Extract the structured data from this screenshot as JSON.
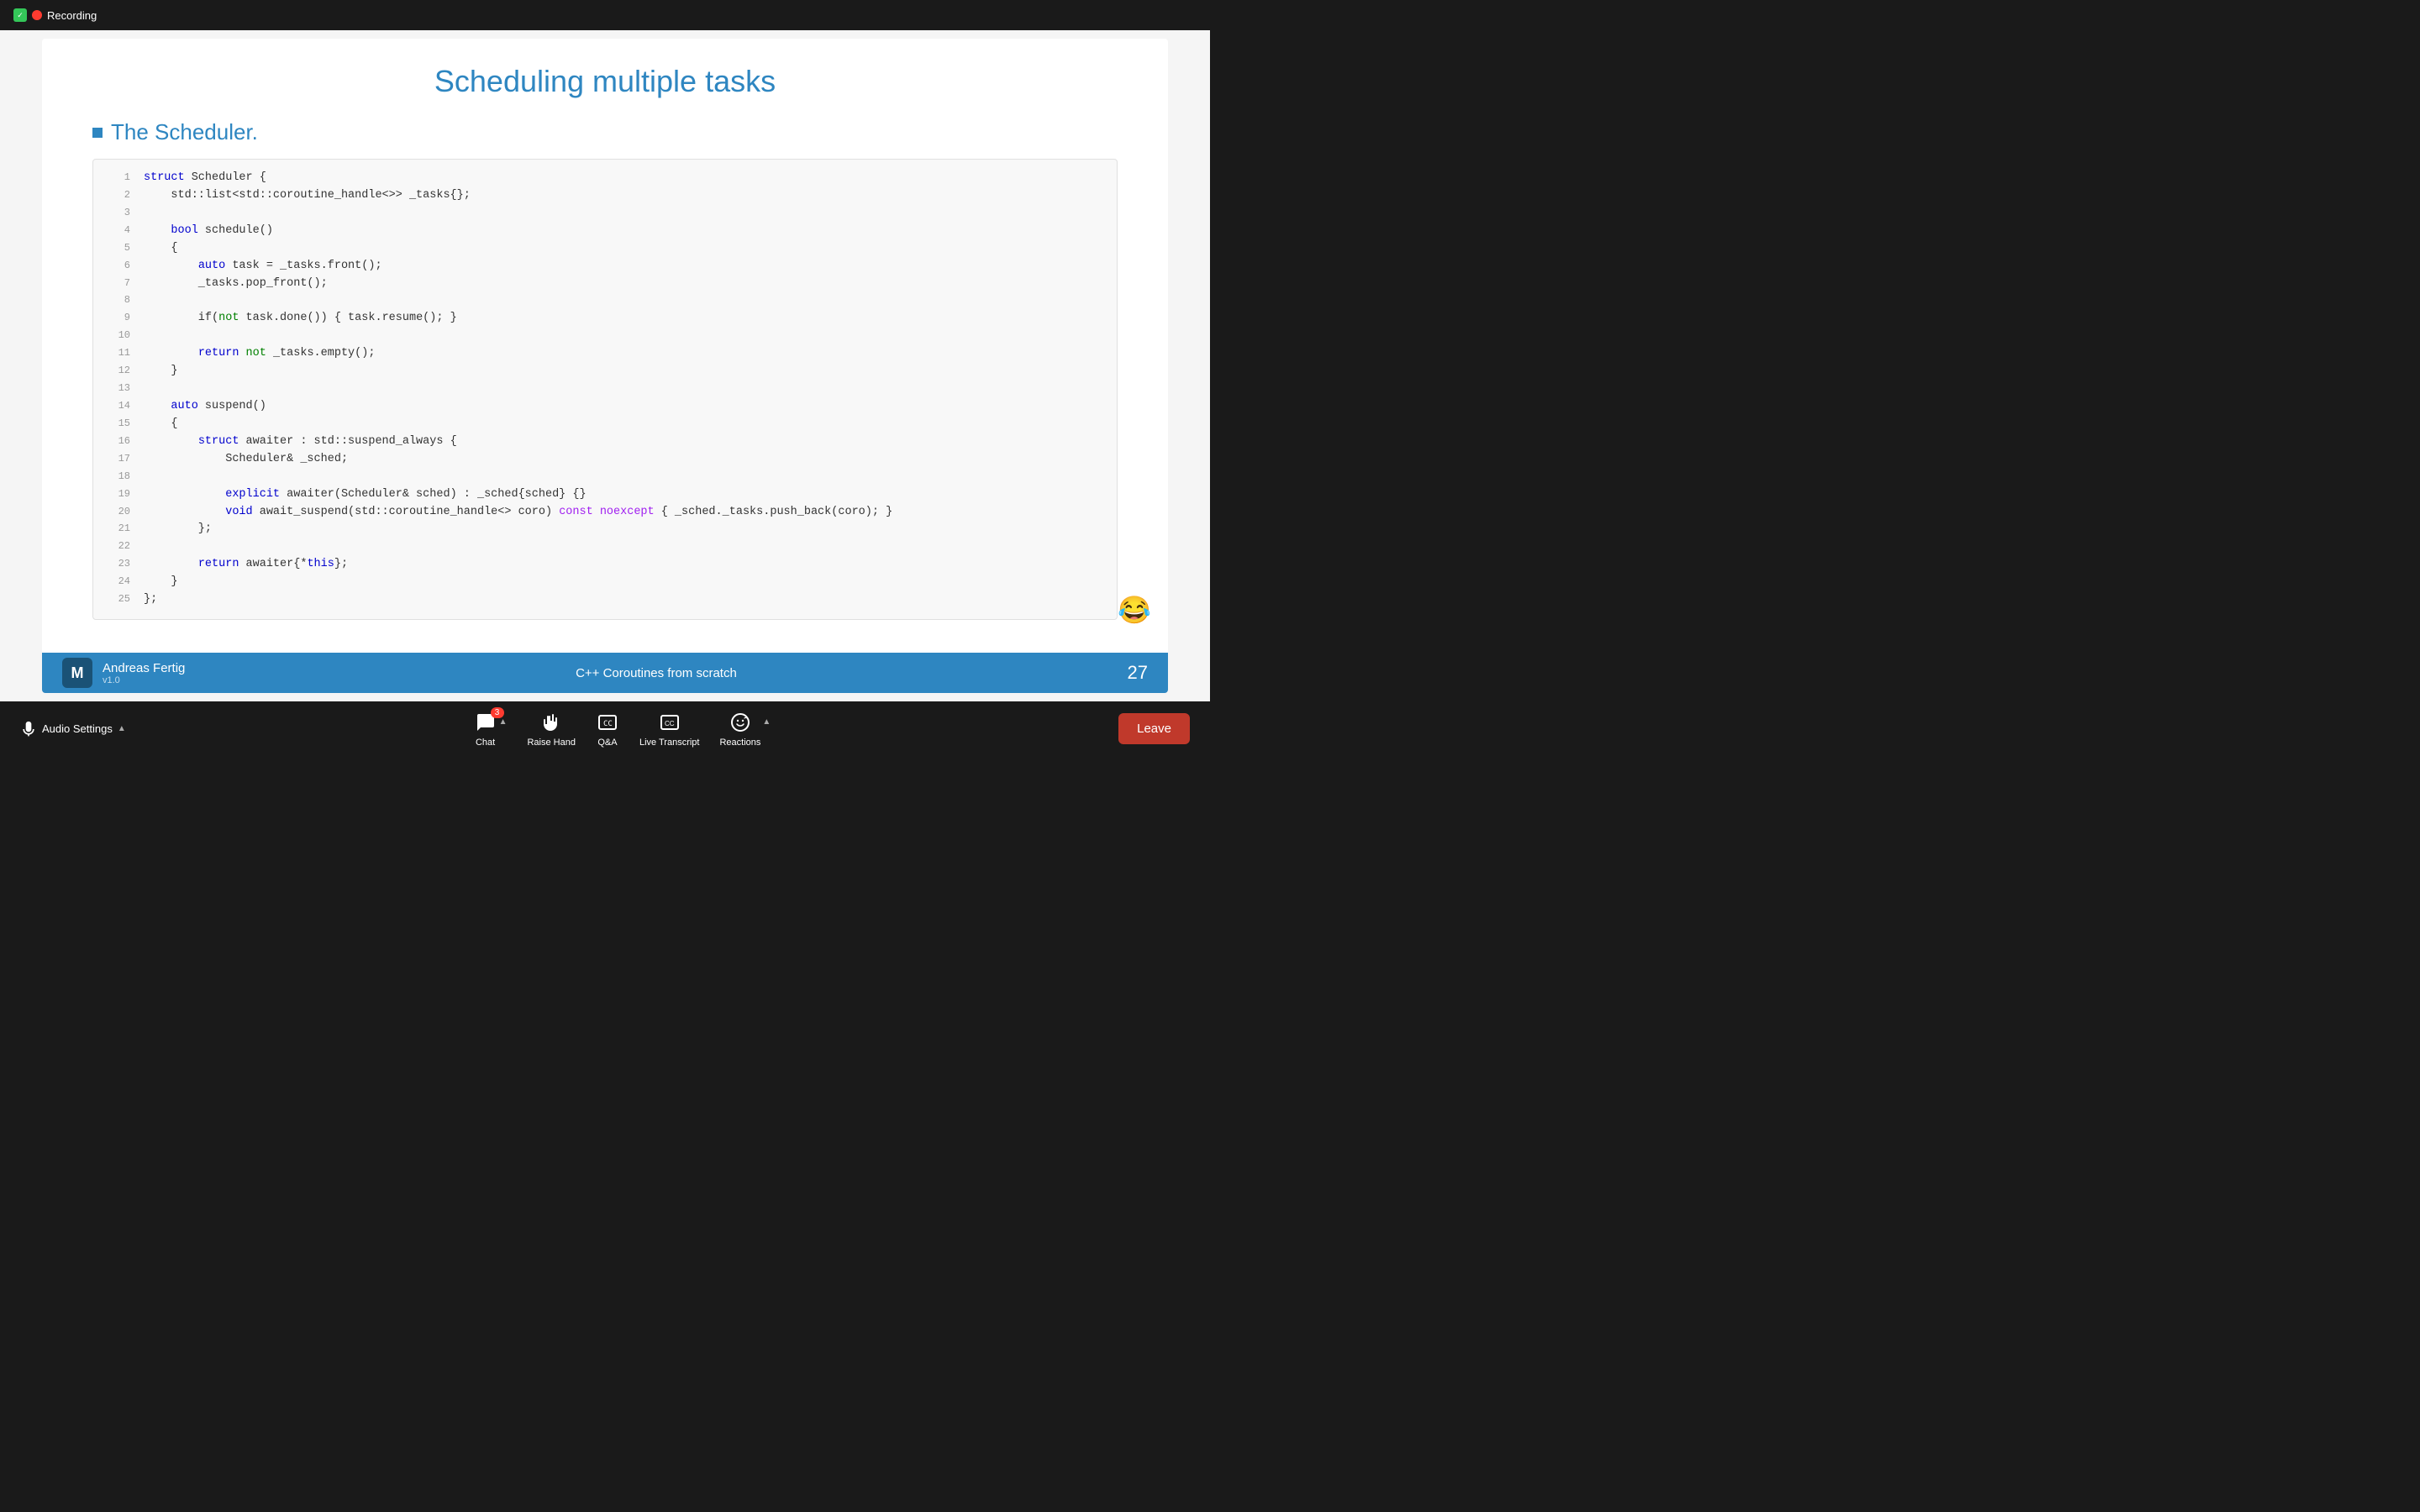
{
  "topbar": {
    "shield_label": "✓",
    "recording_label": "Recording"
  },
  "slide": {
    "title": "Scheduling multiple tasks",
    "section_title": "The Scheduler.",
    "code_lines": [
      {
        "num": 1,
        "text": "struct Scheduler {"
      },
      {
        "num": 2,
        "text": "    std::list<std::coroutine_handle<>> _tasks{};"
      },
      {
        "num": 3,
        "text": ""
      },
      {
        "num": 4,
        "text": "    bool schedule()"
      },
      {
        "num": 5,
        "text": "    {"
      },
      {
        "num": 6,
        "text": "        auto task = _tasks.front();"
      },
      {
        "num": 7,
        "text": "        _tasks.pop_front();"
      },
      {
        "num": 8,
        "text": ""
      },
      {
        "num": 9,
        "text": "        if(not task.done()) { task.resume(); }"
      },
      {
        "num": 10,
        "text": ""
      },
      {
        "num": 11,
        "text": "        return not _tasks.empty();"
      },
      {
        "num": 12,
        "text": "    }"
      },
      {
        "num": 13,
        "text": ""
      },
      {
        "num": 14,
        "text": "    auto suspend()"
      },
      {
        "num": 15,
        "text": "    {"
      },
      {
        "num": 16,
        "text": "        struct awaiter : std::suspend_always {"
      },
      {
        "num": 17,
        "text": "            Scheduler& _sched;"
      },
      {
        "num": 18,
        "text": ""
      },
      {
        "num": 19,
        "text": "            explicit awaiter(Scheduler& sched) : _sched{sched} {}"
      },
      {
        "num": 20,
        "text": "            void await_suspend(std::coroutine_handle<> coro) const noexcept { _sched._tasks.push_back(coro); }"
      },
      {
        "num": 21,
        "text": "        };"
      },
      {
        "num": 22,
        "text": ""
      },
      {
        "num": 23,
        "text": "        return awaiter{*this};"
      },
      {
        "num": 24,
        "text": "    }"
      },
      {
        "num": 25,
        "text": "};"
      }
    ],
    "footer": {
      "logo": "M",
      "presenter": "Andreas Fertig",
      "version": "v1.0",
      "course": "C++ Coroutines from scratch",
      "page": "27"
    }
  },
  "emoji": "😂",
  "bottombar": {
    "audio_label": "Audio Settings",
    "chat_label": "Chat",
    "chat_badge": "3",
    "raise_hand_label": "Raise Hand",
    "qa_label": "Q&A",
    "transcript_label": "Live Transcript",
    "reactions_label": "Reactions",
    "leave_label": "Leave"
  }
}
